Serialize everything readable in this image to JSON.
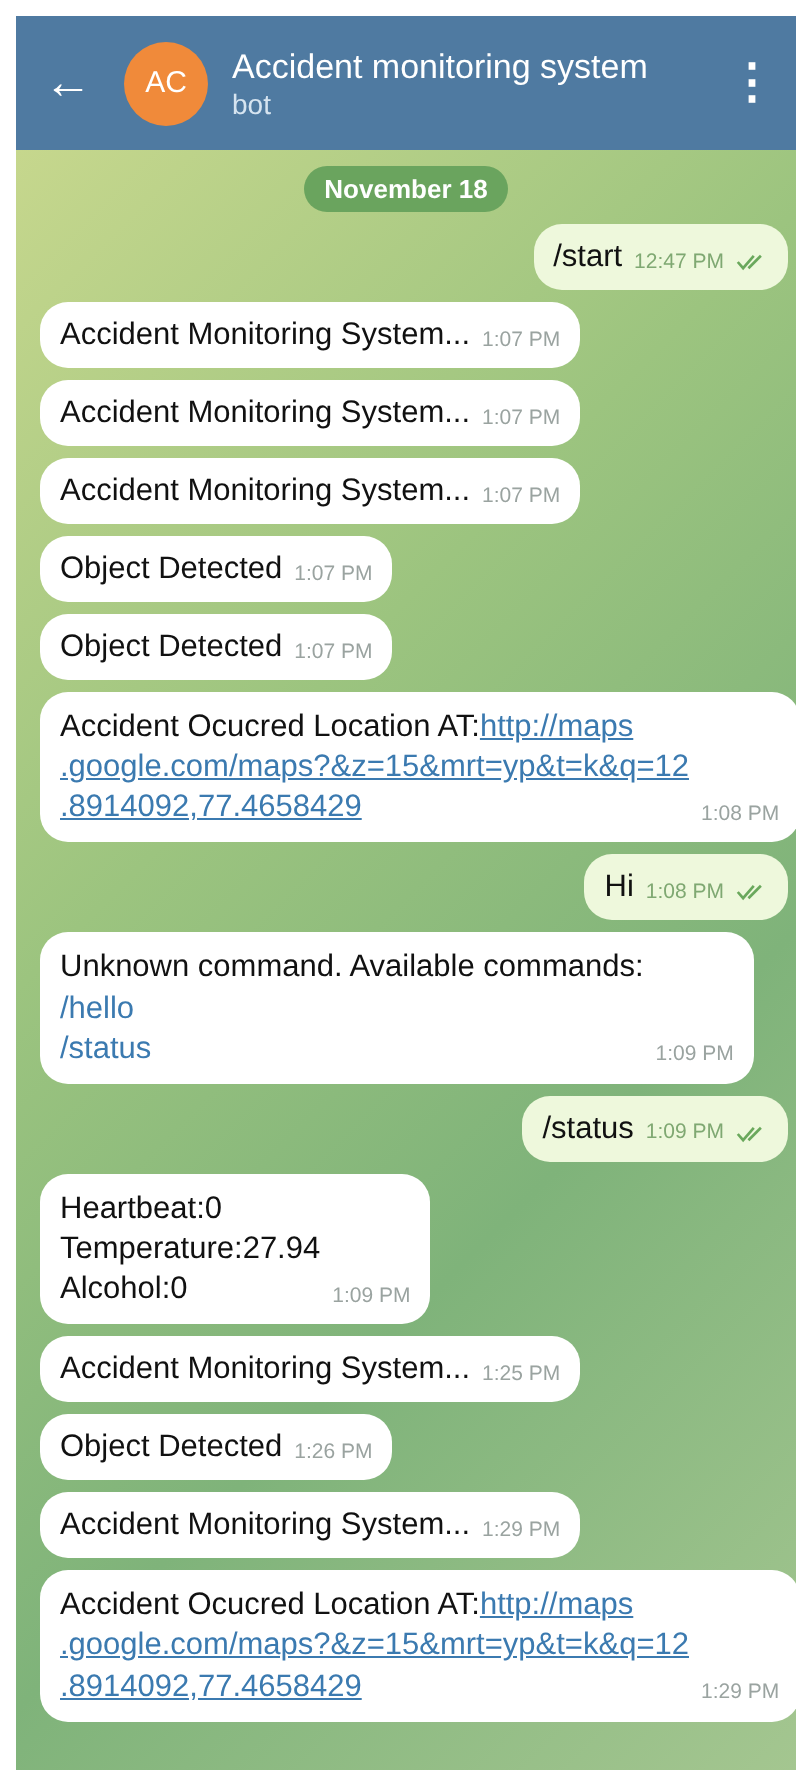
{
  "header": {
    "back": "←",
    "avatar": "AC",
    "title": "Accident monitoring system",
    "subtitle": "bot",
    "menu": "⋮"
  },
  "date": "November 18",
  "messages": [
    {
      "outgoing": true,
      "kind": "text",
      "text": "/start",
      "time": "12:47 PM",
      "read": true
    },
    {
      "outgoing": false,
      "kind": "text",
      "text": "Accident Monitoring System...",
      "time": "1:07 PM"
    },
    {
      "outgoing": false,
      "kind": "text",
      "text": "Accident Monitoring System...",
      "time": "1:07 PM"
    },
    {
      "outgoing": false,
      "kind": "text",
      "text": "Accident Monitoring System...",
      "time": "1:07 PM"
    },
    {
      "outgoing": false,
      "kind": "text",
      "text": "Object Detected",
      "time": "1:07 PM"
    },
    {
      "outgoing": false,
      "kind": "text",
      "text": "Object Detected",
      "time": "1:07 PM"
    },
    {
      "outgoing": false,
      "kind": "location",
      "text": "Accident Ocucred Location AT:",
      "link": [
        "http://maps",
        ".google.com/maps?&z=15&mrt=yp&t=k&q=12",
        ".8914092,77.4658429"
      ],
      "time": "1:08 PM"
    },
    {
      "outgoing": true,
      "kind": "text",
      "text": "Hi",
      "time": "1:08 PM",
      "read": true
    },
    {
      "outgoing": false,
      "kind": "commands",
      "text": "Unknown command. Available commands:",
      "commands": [
        "/hello",
        "/status"
      ],
      "time": "1:09 PM"
    },
    {
      "outgoing": true,
      "kind": "text",
      "text": "/status",
      "time": "1:09 PM",
      "read": true
    },
    {
      "outgoing": false,
      "kind": "lines",
      "lines": [
        "Heartbeat:0",
        "Temperature:27.94",
        "Alcohol:0"
      ],
      "time": "1:09 PM"
    },
    {
      "outgoing": false,
      "kind": "text",
      "text": "Accident Monitoring System...",
      "time": "1:25 PM"
    },
    {
      "outgoing": false,
      "kind": "text",
      "text": "Object Detected",
      "time": "1:26 PM"
    },
    {
      "outgoing": false,
      "kind": "text",
      "text": "Accident Monitoring System...",
      "time": "1:29 PM"
    },
    {
      "outgoing": false,
      "kind": "location",
      "text": "Accident Ocucred Location AT:",
      "link": [
        "http://maps",
        ".google.com/maps?&z=15&mrt=yp&t=k&q=12",
        ".8914092,77.4658429"
      ],
      "time": "1:29 PM"
    }
  ]
}
